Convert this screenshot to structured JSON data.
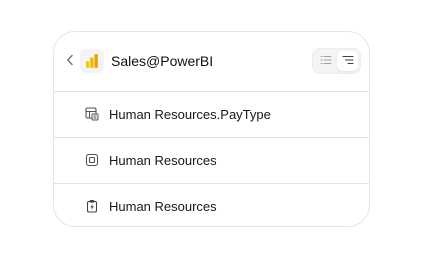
{
  "header": {
    "title": "Sales@PowerBI",
    "back_icon": "chevron-left-icon",
    "app_icon": "powerbi-icon",
    "view_toggle": {
      "options": [
        "list-icon",
        "tree-icon"
      ],
      "selected": "tree-icon"
    }
  },
  "items": [
    {
      "label": "Human Resources.PayType",
      "icon": "table-icon"
    },
    {
      "label": "Human Resources",
      "icon": "schema-icon"
    },
    {
      "label": "Human Resources",
      "icon": "clipboard-icon"
    }
  ],
  "colors": {
    "border": "#e4e4e7",
    "powerbi_yellow": "#f2c811",
    "powerbi_dark": "#e8a400"
  }
}
